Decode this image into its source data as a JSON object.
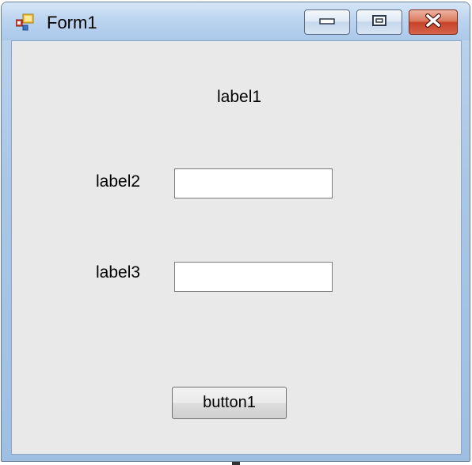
{
  "window": {
    "title": "Form1",
    "controls": {
      "minimize_icon": "minimize-icon",
      "maximize_icon": "restore-icon",
      "close_icon": "close-icon"
    }
  },
  "form": {
    "label1": "label1",
    "label2": "label2",
    "label3": "label3",
    "textbox1": {
      "value": "",
      "placeholder": ""
    },
    "textbox2": {
      "value": "",
      "placeholder": ""
    },
    "button1": "button1"
  },
  "colors": {
    "client_background": "#eae9ea",
    "titlebar": "#bcd4ef",
    "close_button": "#c7432a"
  }
}
